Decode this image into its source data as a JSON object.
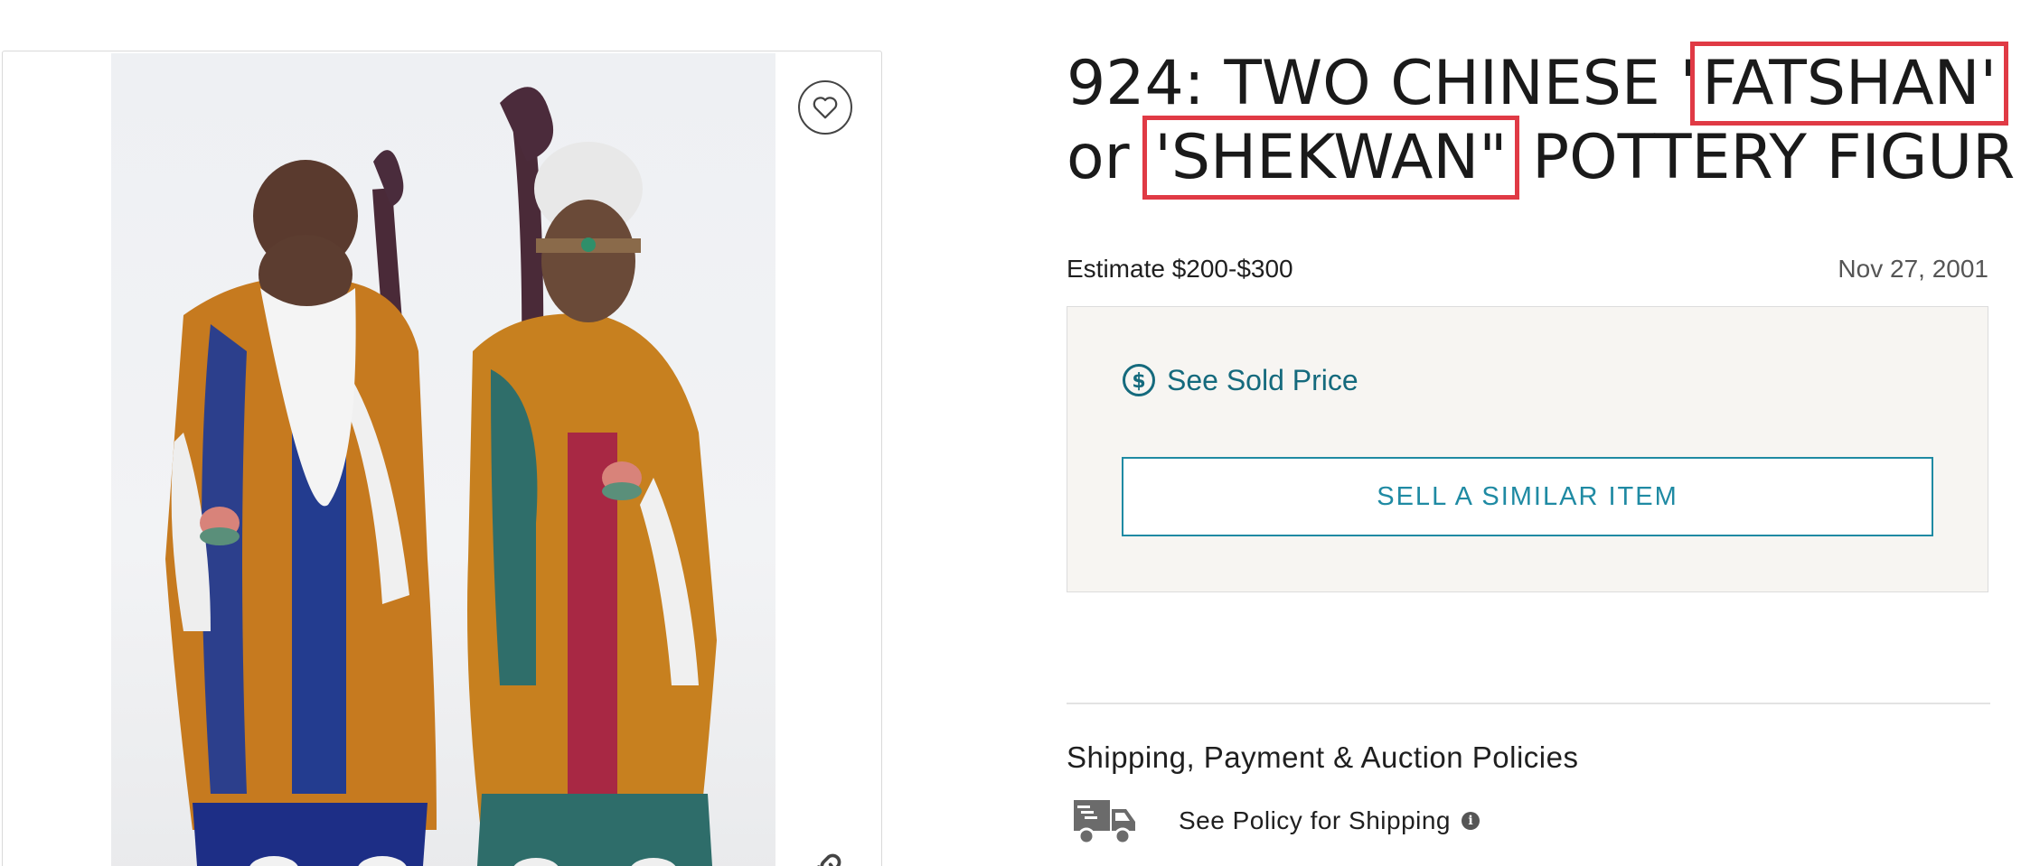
{
  "lot": {
    "title_parts": {
      "prefix": "924: TWO CHINESE '",
      "highlight1": "FATSHAN'",
      "middle": "or ",
      "highlight2": "'SHEKWAN\"",
      "suffix": " POTTERY FIGURES"
    },
    "estimate": "Estimate $200-$300",
    "date": "Nov 27, 2001"
  },
  "actions": {
    "see_sold_price": "See Sold Price",
    "sell_similar": "SELL A SIMILAR ITEM"
  },
  "policies": {
    "heading": "Shipping, Payment & Auction Policies",
    "shipping_link": "See Policy for Shipping",
    "info_glyph": "i"
  },
  "icons": {
    "favorite": "heart-icon",
    "share": "share-icon",
    "dollar": "dollar-circle-icon",
    "truck": "truck-icon",
    "info": "info-icon"
  },
  "colors": {
    "accent_teal": "#156a7d",
    "button_teal": "#1f8aa3",
    "highlight_red": "#e03a45",
    "price_box_bg": "#f7f5f2"
  }
}
